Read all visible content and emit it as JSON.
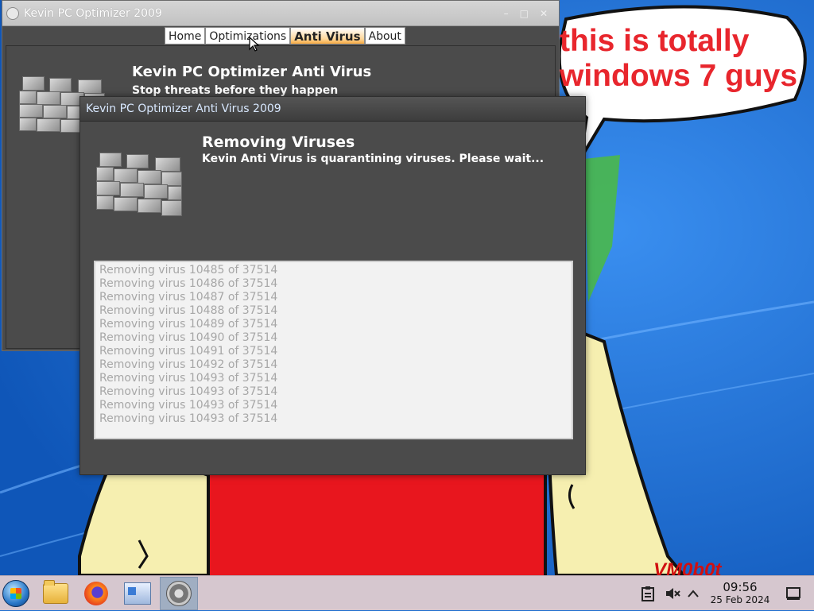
{
  "main_window": {
    "title": "Kevin PC Optimizer 2009",
    "controls": {
      "minimize": "–",
      "maximize": "□",
      "close": "✕"
    },
    "tabs": [
      {
        "label": "Home",
        "active": false
      },
      {
        "label": "Optimizations",
        "active": false
      },
      {
        "label": "Anti Virus",
        "active": true
      },
      {
        "label": "About",
        "active": false
      }
    ],
    "heading": "Kevin PC Optimizer Anti Virus",
    "subheading": "Stop threats before they happen"
  },
  "dialog": {
    "title": "Kevin PC Optimizer Anti Virus 2009",
    "heading": "Removing Viruses",
    "subheading": "Kevin Anti Virus is quarantining viruses. Please wait...",
    "log_lines": [
      "Removing virus 10485 of 37514",
      "Removing virus 10486 of 37514",
      "Removing virus 10487 of 37514",
      "Removing virus 10488 of 37514",
      "Removing virus 10489 of 37514",
      "Removing virus 10490 of 37514",
      "Removing virus 10491 of 37514",
      "Removing virus 10492 of 37514",
      "Removing virus 10493 of 37514",
      "Removing virus 10493 of 37514",
      "Removing virus 10493 of 37514",
      "Removing virus 10493 of 37514"
    ]
  },
  "desktop": {
    "speech_bubble_lines": [
      "this is totally",
      "windows 7 guys"
    ],
    "watermark": "VM0b0t"
  },
  "taskbar": {
    "items": [
      "start-orb-icon",
      "file-manager-icon",
      "firefox-icon",
      "system-settings-icon",
      "kevin-optimizer-icon"
    ],
    "tray_icons": [
      "clipboard-icon",
      "volume-muted-icon",
      "chevron-up-icon",
      "show-desktop-icon"
    ],
    "clock": {
      "time": "09:56",
      "date": "25 Feb 2024"
    }
  },
  "colors": {
    "desktop_blue": "#1e6fd0",
    "window_gray": "#4b4b4b",
    "bubble_text_red": "#e8262d",
    "active_tab_orange": "#f6a940",
    "taskbar_pink": "#d6c7cf"
  }
}
